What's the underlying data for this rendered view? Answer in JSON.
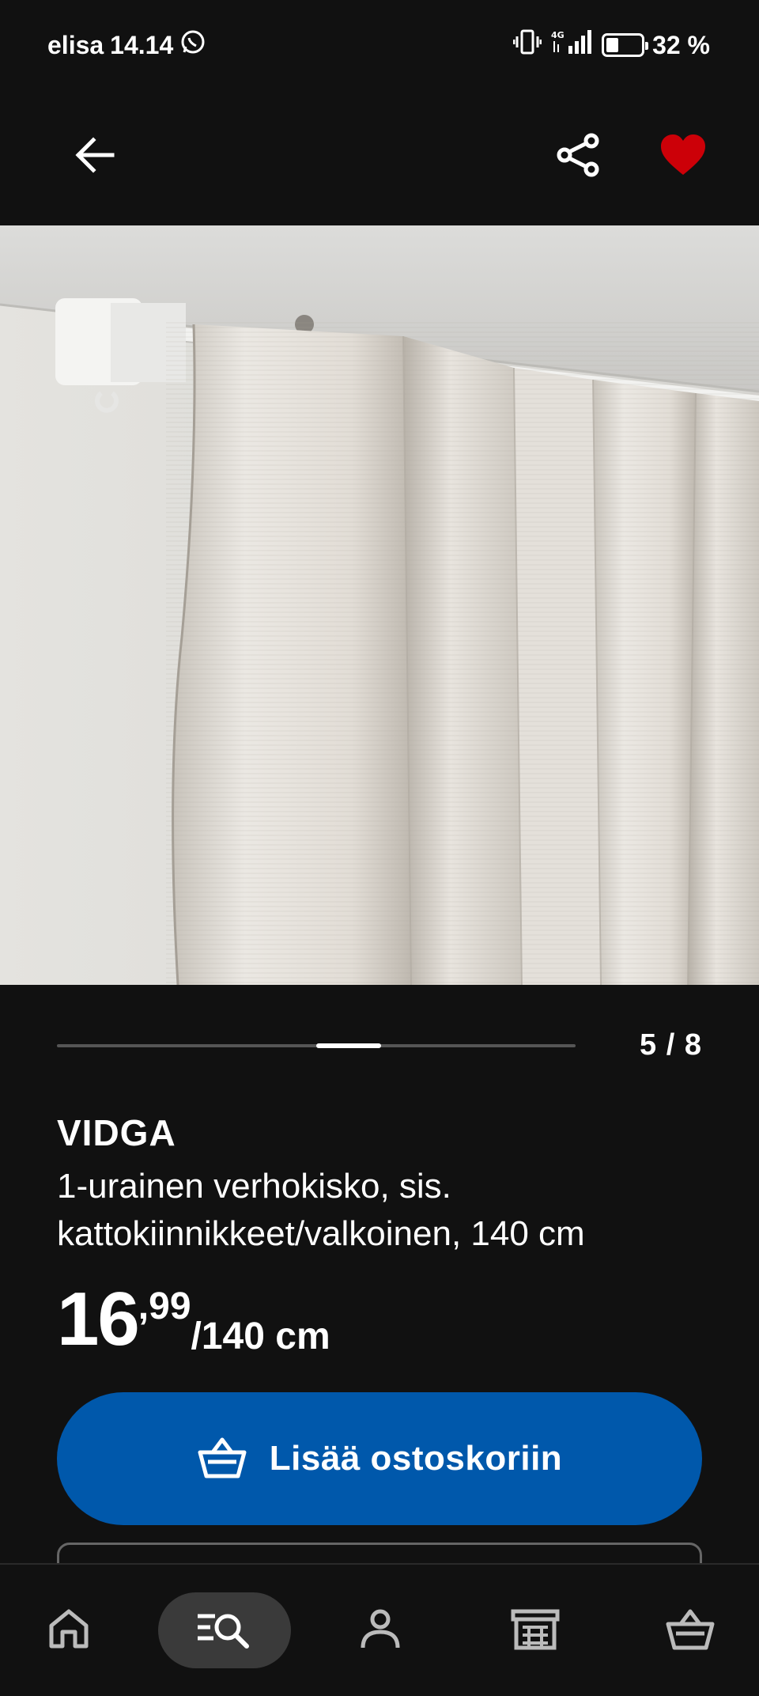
{
  "status": {
    "carrier": "elisa",
    "time": "14.14",
    "network": "4G",
    "battery": "32 %",
    "battery_level": 0.32
  },
  "header": {
    "back_icon": "arrow-left-icon",
    "share_icon": "share-icon",
    "favorite_icon": "heart-filled-icon",
    "favorite_color": "#cc0008"
  },
  "gallery": {
    "counter": "5 / 8",
    "current": 5,
    "total": 8
  },
  "product": {
    "name": "VIDGA",
    "description": "1-urainen verhokisko, sis. kattokiinnikkeet/valkoinen, 140 cm",
    "price_integer": "16",
    "price_decimal": ",99",
    "price_unit": "/140 cm"
  },
  "actions": {
    "add_to_cart": "Lisää ostoskoriin",
    "add_to_cart_color": "#0058ab"
  },
  "bottom_nav": [
    {
      "name": "home",
      "icon": "home-icon",
      "active": false
    },
    {
      "name": "search",
      "icon": "search-list-icon",
      "active": true
    },
    {
      "name": "account",
      "icon": "person-icon",
      "active": false
    },
    {
      "name": "store",
      "icon": "store-icon",
      "active": false
    },
    {
      "name": "cart",
      "icon": "basket-icon",
      "active": false
    }
  ]
}
